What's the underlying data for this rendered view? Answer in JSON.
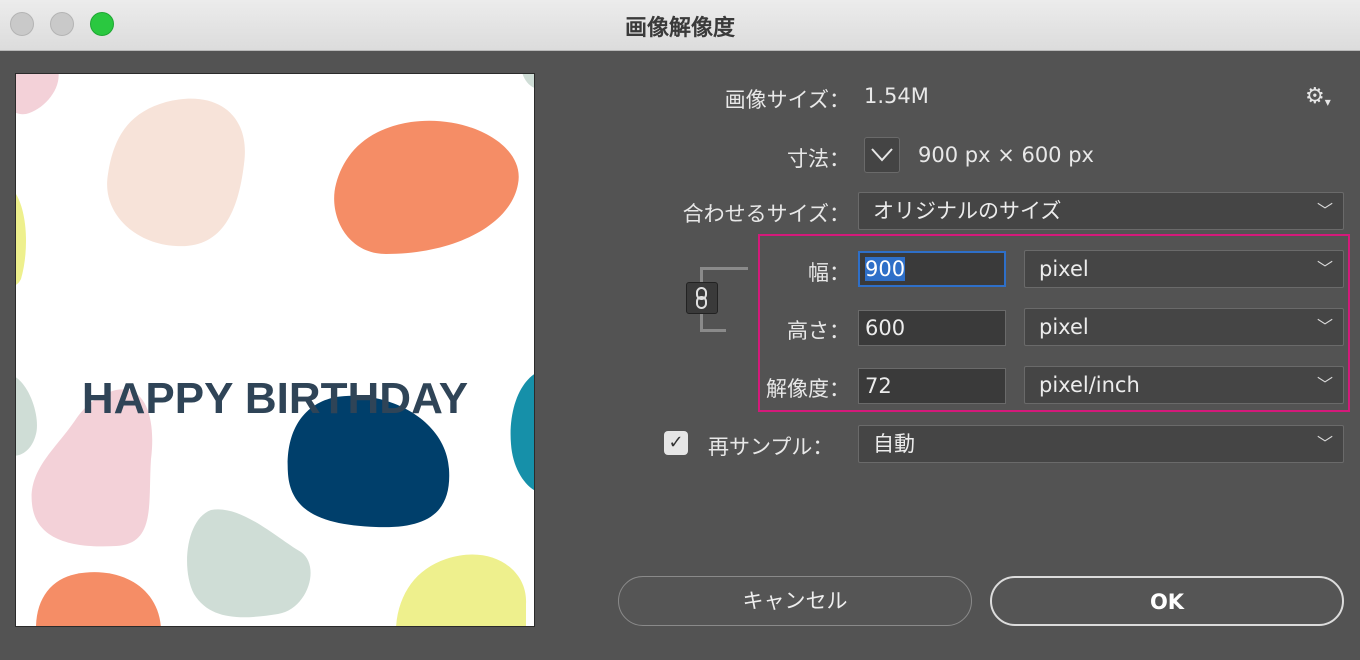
{
  "window": {
    "title": "画像解像度"
  },
  "preview": {
    "text": "HAPPY BIRTHDAY"
  },
  "image_size": {
    "label": "画像サイズ：",
    "value": "1.54M"
  },
  "dimensions": {
    "label": "寸法：",
    "value": "900 px × 600 px"
  },
  "fit_to": {
    "label": "合わせるサイズ：",
    "value": "オリジナルのサイズ"
  },
  "width": {
    "label": "幅：",
    "value": "900",
    "unit": "pixel"
  },
  "height": {
    "label": "高さ：",
    "value": "600",
    "unit": "pixel"
  },
  "resolution": {
    "label": "解像度：",
    "value": "72",
    "unit": "pixel/inch"
  },
  "resample": {
    "label": "再サンプル：",
    "checked": true,
    "value": "自動"
  },
  "buttons": {
    "cancel": "キャンセル",
    "ok": "OK"
  },
  "colors": {
    "highlight": "#d4197a",
    "focus": "#2e6fc8",
    "green_light": "#2ac840"
  }
}
